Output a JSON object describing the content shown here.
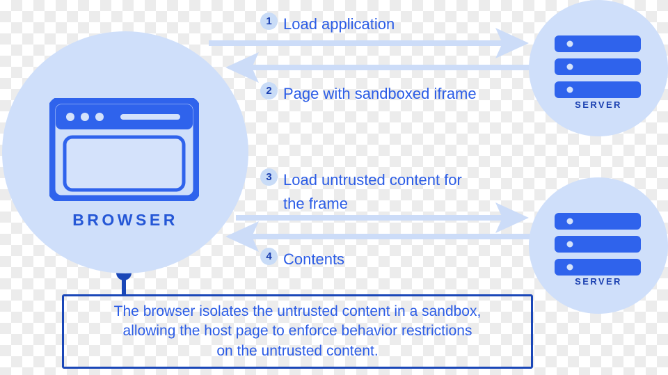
{
  "diagram": {
    "title": "Browser sandboxed iframe request flow",
    "colors": {
      "node_fill": "#cfdffa",
      "arrow": "#ccdcf8",
      "accent_blue": "#2b5ce6",
      "deep_blue": "#1a3fb0",
      "callout_border": "#1a47b8",
      "badge_fill": "#c9dcf7"
    }
  },
  "browser_node": {
    "label": "BROWSER",
    "icon": "browser-window-icon"
  },
  "servers": [
    {
      "label": "SERVER",
      "icon": "server-rack-icon"
    },
    {
      "label": "SERVER",
      "icon": "server-rack-icon"
    }
  ],
  "steps": [
    {
      "number": "1",
      "text": "Load application",
      "direction": "browser-to-server",
      "arrow": "arrow-right-icon"
    },
    {
      "number": "2",
      "text": "Page with sandboxed iframe",
      "direction": "server-to-browser",
      "arrow": "arrow-left-icon"
    },
    {
      "number": "3",
      "text": "Load untrusted content for\nthe frame",
      "direction": "browser-to-server",
      "arrow": "arrow-right-icon"
    },
    {
      "number": "4",
      "text": "Contents",
      "direction": "server-to-browser",
      "arrow": "arrow-left-icon"
    }
  ],
  "callout": {
    "text": "The browser isolates the untrusted content in a sandbox,\nallowing the host page to enforce behavior restrictions\non the untrusted content."
  }
}
